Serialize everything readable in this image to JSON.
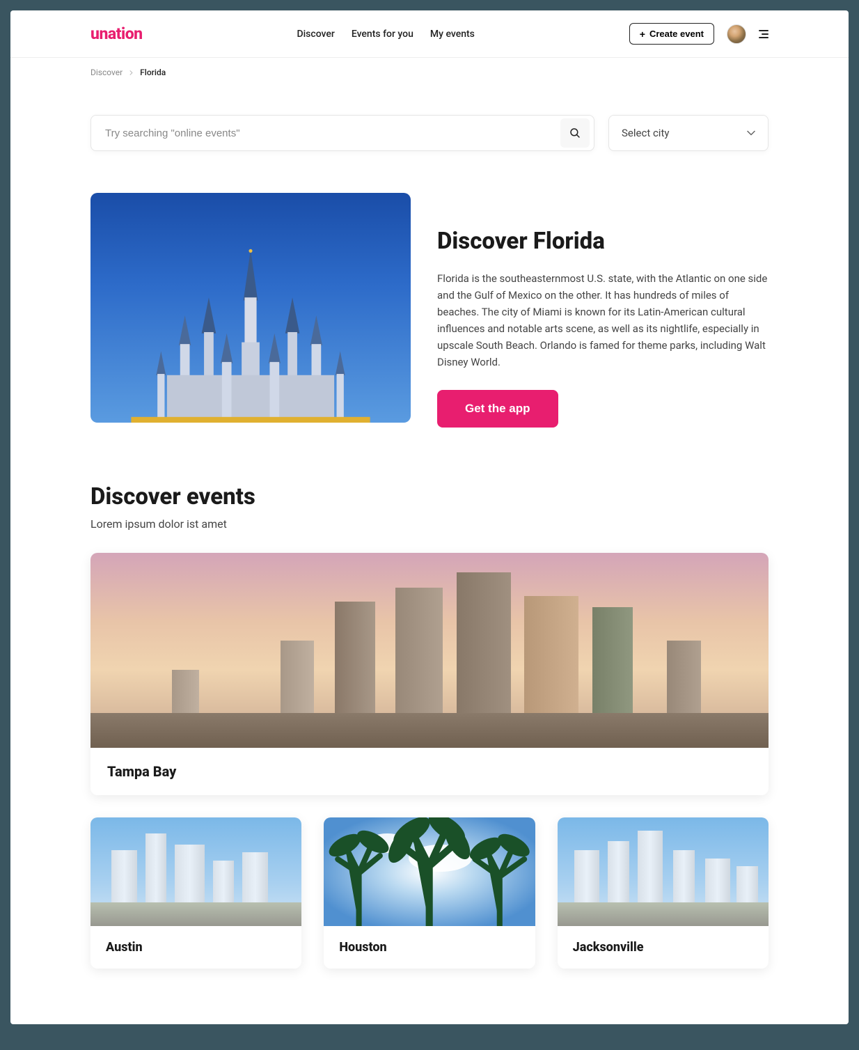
{
  "brand": "unation",
  "nav": {
    "discover": "Discover",
    "events_for_you": "Events for you",
    "my_events": "My events"
  },
  "header": {
    "create_event_label": "Create event"
  },
  "breadcrumb": {
    "root": "Discover",
    "current": "Florida"
  },
  "search": {
    "placeholder": "Try searching \"online events\""
  },
  "city_select": {
    "label": "Select city"
  },
  "hero": {
    "title": "Discover Florida",
    "description": "Florida is the southeasternmost U.S. state, with the Atlantic on one side and the Gulf of Mexico on the other. It has hundreds of miles of beaches. The city of Miami is known for its Latin-American cultural influences and notable arts scene, as well as its nightlife, especially in upscale South Beach. Orlando is famed for theme parks, including Walt Disney World.",
    "cta_label": "Get the app"
  },
  "events_section": {
    "title": "Discover events",
    "subtitle": "Lorem ipsum dolor ist amet",
    "featured": {
      "name": "Tampa Bay"
    },
    "cities": [
      {
        "name": "Austin"
      },
      {
        "name": "Houston"
      },
      {
        "name": "Jacksonville"
      }
    ]
  },
  "colors": {
    "accent": "#e81e6f",
    "text": "#1a1a1a",
    "muted": "#888"
  }
}
